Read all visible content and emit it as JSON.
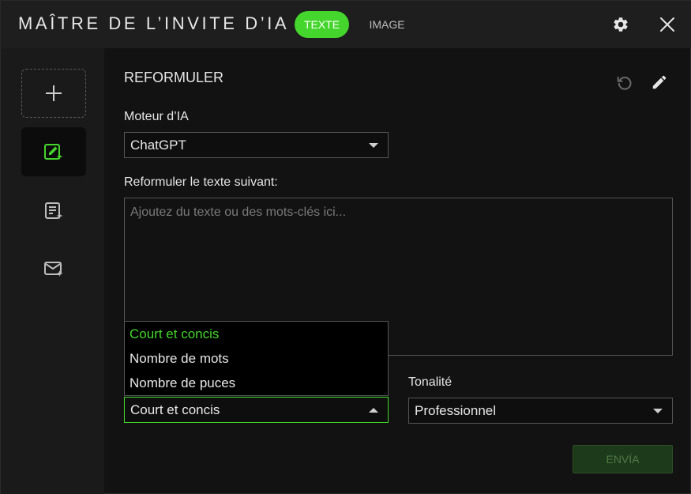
{
  "window": {
    "title": "MAÎTRE DE L’INVITE D’IA"
  },
  "header": {
    "tabs": [
      {
        "label": "TEXTE",
        "active": true
      },
      {
        "label": "IMAGE",
        "active": false
      }
    ],
    "icons": {
      "settings": "gear-icon",
      "close": "close-icon"
    }
  },
  "sidebar": {
    "items": [
      {
        "icon": "plus-icon",
        "kind": "add"
      },
      {
        "icon": "edit-sparkle-icon",
        "active": true
      },
      {
        "icon": "document-sparkle-icon",
        "active": false
      },
      {
        "icon": "mail-sparkle-icon",
        "active": false
      }
    ]
  },
  "main": {
    "section_title": "REFORMULER",
    "engine": {
      "label": "Moteur d’IA",
      "value": "ChatGPT"
    },
    "prompt": {
      "label": "Reformuler le texte suivant:",
      "placeholder": "Ajoutez du texte ou des mots-clés ici...",
      "value": ""
    },
    "length": {
      "value": "Court et concis",
      "options": [
        "Court et concis",
        "Nombre de mots",
        "Nombre de puces"
      ],
      "open": true
    },
    "tone": {
      "label": "Tonalité",
      "value": "Professionnel"
    },
    "send_label": "ENVÍA"
  },
  "colors": {
    "accent": "#44d62c",
    "background": "#121212",
    "panel": "#1e1e1e"
  }
}
